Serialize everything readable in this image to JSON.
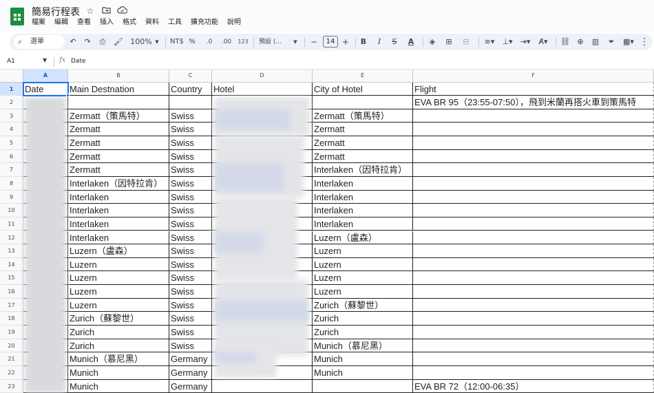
{
  "doc": {
    "title": "簡易行程表",
    "icons": [
      "star-icon",
      "move-to-folder-icon",
      "cloud-status-icon"
    ]
  },
  "menu": [
    "檔案",
    "編輯",
    "查看",
    "插入",
    "格式",
    "資料",
    "工具",
    "擴充功能",
    "說明"
  ],
  "toolbar": {
    "search_label": "選單",
    "zoom": "100%",
    "currency": "NT$",
    "percent": "%",
    "decrease_decimal": ".0",
    "increase_decimal": ".00",
    "number_format": "123",
    "font_name": "預設 (...",
    "font_size": "14",
    "minus": "−",
    "plus": "+"
  },
  "formula_bar": {
    "cell_ref": "A1",
    "fx": "fx",
    "value": "Date"
  },
  "columns": [
    "A",
    "B",
    "C",
    "D",
    "E",
    "F"
  ],
  "rows": [
    [
      "Date",
      "Main Destnation",
      "Country",
      "Hotel",
      "City of Hotel",
      "Flight"
    ],
    [
      "",
      "",
      "",
      "",
      "",
      "EVA BR 95（23:55-07:50），飛到米蘭再搭火車到策馬特"
    ],
    [
      "",
      "Zermatt（策馬特）",
      "Swiss",
      "",
      "Zermatt（策馬特）",
      ""
    ],
    [
      "",
      "Zermatt",
      "Swiss",
      "",
      "Zermatt",
      ""
    ],
    [
      "",
      "Zermatt",
      "Swiss",
      "",
      "Zermatt",
      ""
    ],
    [
      "",
      "Zermatt",
      "Swiss",
      "",
      "Zermatt",
      ""
    ],
    [
      "",
      "Zermatt",
      "Swiss",
      "",
      "Interlaken（因特拉肯）",
      ""
    ],
    [
      "",
      "Interlaken（因特拉肯）",
      "Swiss",
      "",
      "Interlaken",
      ""
    ],
    [
      "",
      "Interlaken",
      "Swiss",
      "",
      "Interlaken",
      ""
    ],
    [
      "",
      "Interlaken",
      "Swiss",
      "",
      "Interlaken",
      ""
    ],
    [
      "",
      "Interlaken",
      "Swiss",
      "",
      "Interlaken",
      ""
    ],
    [
      "",
      "Interlaken",
      "Swiss",
      "",
      "Luzern（盧森）",
      ""
    ],
    [
      "",
      "Luzern（盧森）",
      "Swiss",
      "",
      "Luzern",
      ""
    ],
    [
      "",
      "Luzern",
      "Swiss",
      "",
      "Luzern",
      ""
    ],
    [
      "",
      "Luzern",
      "Swiss",
      "",
      "Luzern",
      ""
    ],
    [
      "",
      "Luzern",
      "Swiss",
      "",
      "Luzern",
      ""
    ],
    [
      "",
      "Luzern",
      "Swiss",
      "",
      "Zurich（蘇黎世）",
      ""
    ],
    [
      "",
      "Zurich（蘇黎世）",
      "Swiss",
      "",
      "Zurich",
      ""
    ],
    [
      "",
      "Zurich",
      "Swiss",
      "",
      "Zurich",
      ""
    ],
    [
      "",
      "Zurich",
      "Swiss",
      "",
      "Munich（慕尼黑）",
      ""
    ],
    [
      "",
      "Munich（慕尼黑）",
      "Germany",
      "",
      "Munich",
      ""
    ],
    [
      "",
      "Munich",
      "Germany",
      "",
      "Munich",
      ""
    ],
    [
      "",
      "Munich",
      "Germany",
      "",
      "",
      "EVA BR 72（12:00-06:35）"
    ]
  ],
  "colors": {
    "accent": "#1a73e8",
    "toolbar_bg": "#edf2fa",
    "header_bg": "#f8f9fa",
    "header_active": "#d3e3fd",
    "logo_green": "#1e8e3e"
  }
}
